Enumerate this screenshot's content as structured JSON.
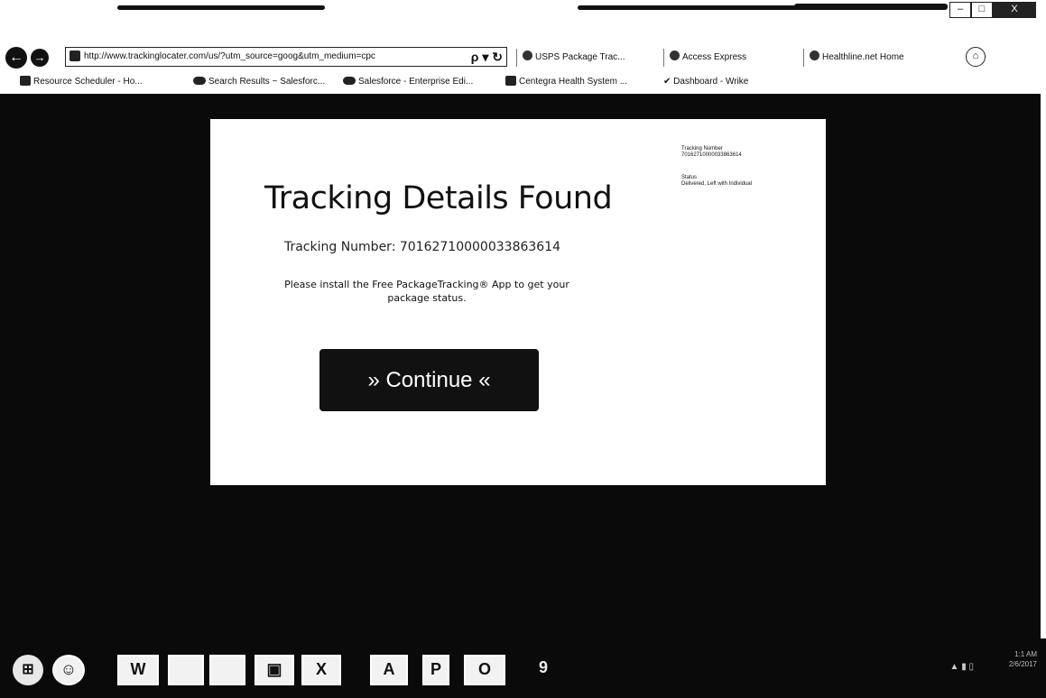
{
  "browser": {
    "address": "http://www.trackinglocater.com/us/?utm_source=goog&utm_medium=cpc",
    "nav": {
      "back_icon": "back-arrow-icon",
      "forward_icon": "forward-arrow-icon",
      "back_glyph": "←",
      "forward_glyph": "→"
    },
    "address_tools": "ρ ▾ ↻",
    "tabs": [
      {
        "label": "USPS Package Trac..."
      },
      {
        "label": "Access Express"
      },
      {
        "label": "Healthline.net Home"
      }
    ],
    "favorites": [
      {
        "label": "Resource Scheduler - Ho..."
      },
      {
        "label": "Search Results ~ Salesforc..."
      },
      {
        "label": "Salesforce - Enterprise Edi..."
      },
      {
        "label": "Centegra Health System ..."
      },
      {
        "label": "Dashboard - Wrike"
      }
    ],
    "window_controls": [
      "–",
      "□",
      "X"
    ]
  },
  "page": {
    "mini_tracking_label": "Tracking Number",
    "mini_tracking_value": "70162710000033863614",
    "mini_status_label": "Status",
    "mini_status_value": "Delivered, Left with Individual",
    "heading": "Tracking Details Found",
    "tracking_line": "Tracking Number: 70162710000033863614",
    "prompt": "Please install the Free PackageTracking® App to get your package status.",
    "continue_label": "» Continue «"
  },
  "taskbar": {
    "start_icon": "windows-start-icon",
    "apps": [
      "☺",
      "W",
      "",
      "",
      "X",
      "A",
      "P",
      "O",
      "9"
    ],
    "time": "1:1 AM",
    "date": "2/6/2017"
  }
}
